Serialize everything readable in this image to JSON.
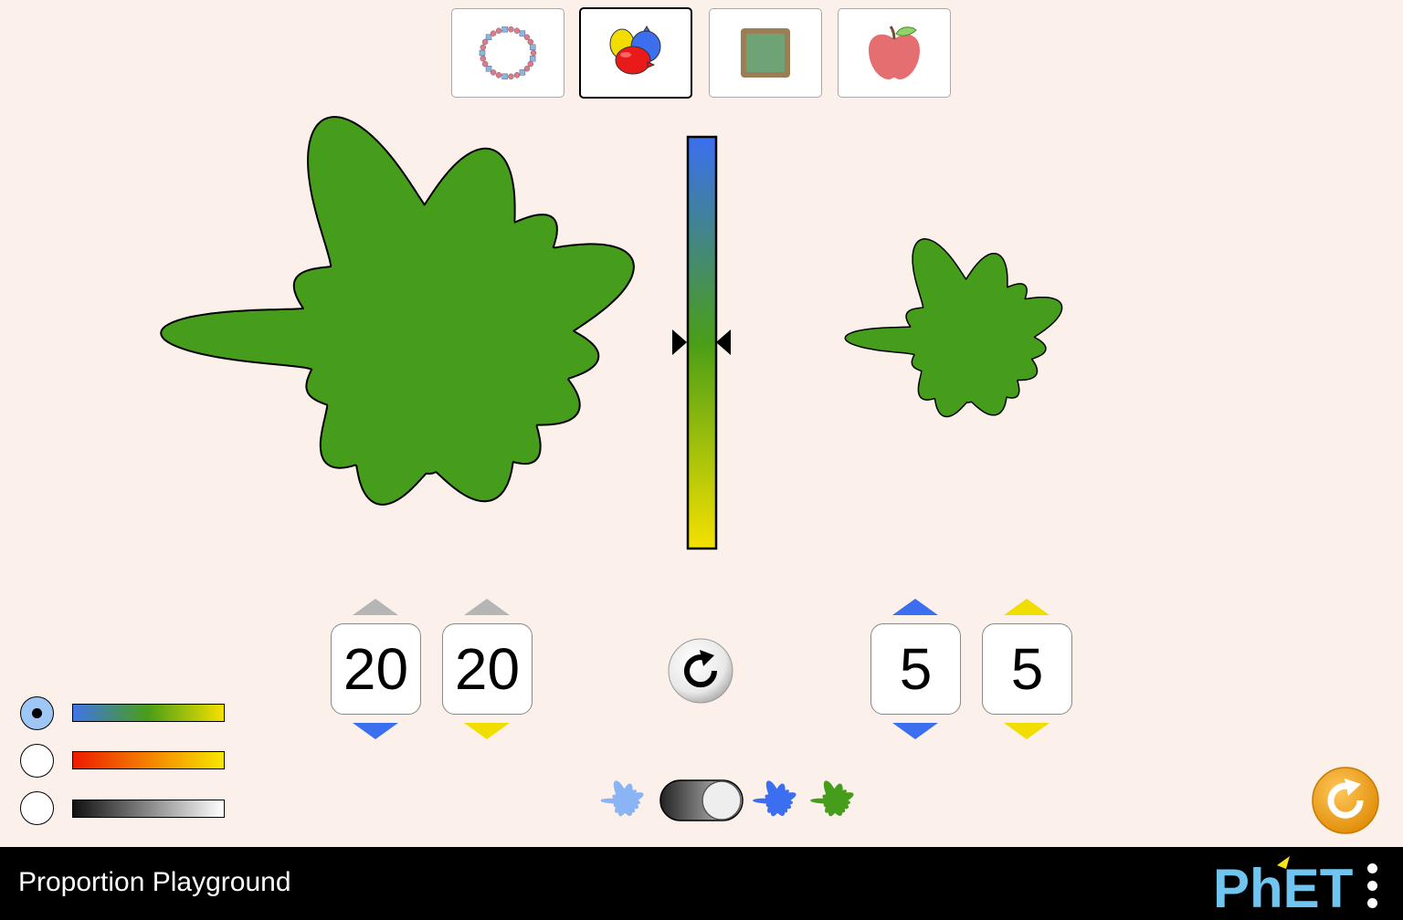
{
  "scene_tabs": [
    {
      "name": "necklace",
      "selected": false
    },
    {
      "name": "paint",
      "selected": true
    },
    {
      "name": "billiards",
      "selected": false
    },
    {
      "name": "apples",
      "selected": false
    }
  ],
  "left_mixture": {
    "blue_count": "20",
    "yellow_count": "20"
  },
  "right_mixture": {
    "blue_count": "5",
    "yellow_count": "5"
  },
  "color_schemes": [
    {
      "id": "blue-yellow",
      "selected": true,
      "from": "#3f74e8",
      "mid": "#4a9e17",
      "to": "#f5e100"
    },
    {
      "id": "red-yellow",
      "selected": false,
      "from": "#ee1c00",
      "to": "#f8e700"
    },
    {
      "id": "black-white",
      "selected": false,
      "from": "#111111",
      "to": "#ffffff"
    }
  ],
  "colors": {
    "paint_green": "#469d1b",
    "paint_blue": "#3b6ff0",
    "paint_yellow": "#f2dd00",
    "paint_light_blue": "#8bb4f4",
    "background": "#fbf1ea",
    "reset_orange": "#f0a01d"
  },
  "view_toggle": {
    "left_icon": "light-blue-splotch-icon",
    "right_icons": [
      "blue-splotch-icon",
      "green-splotch-icon"
    ],
    "state": "right"
  },
  "footer": {
    "title": "Proportion Playground",
    "brand": "PhET"
  }
}
